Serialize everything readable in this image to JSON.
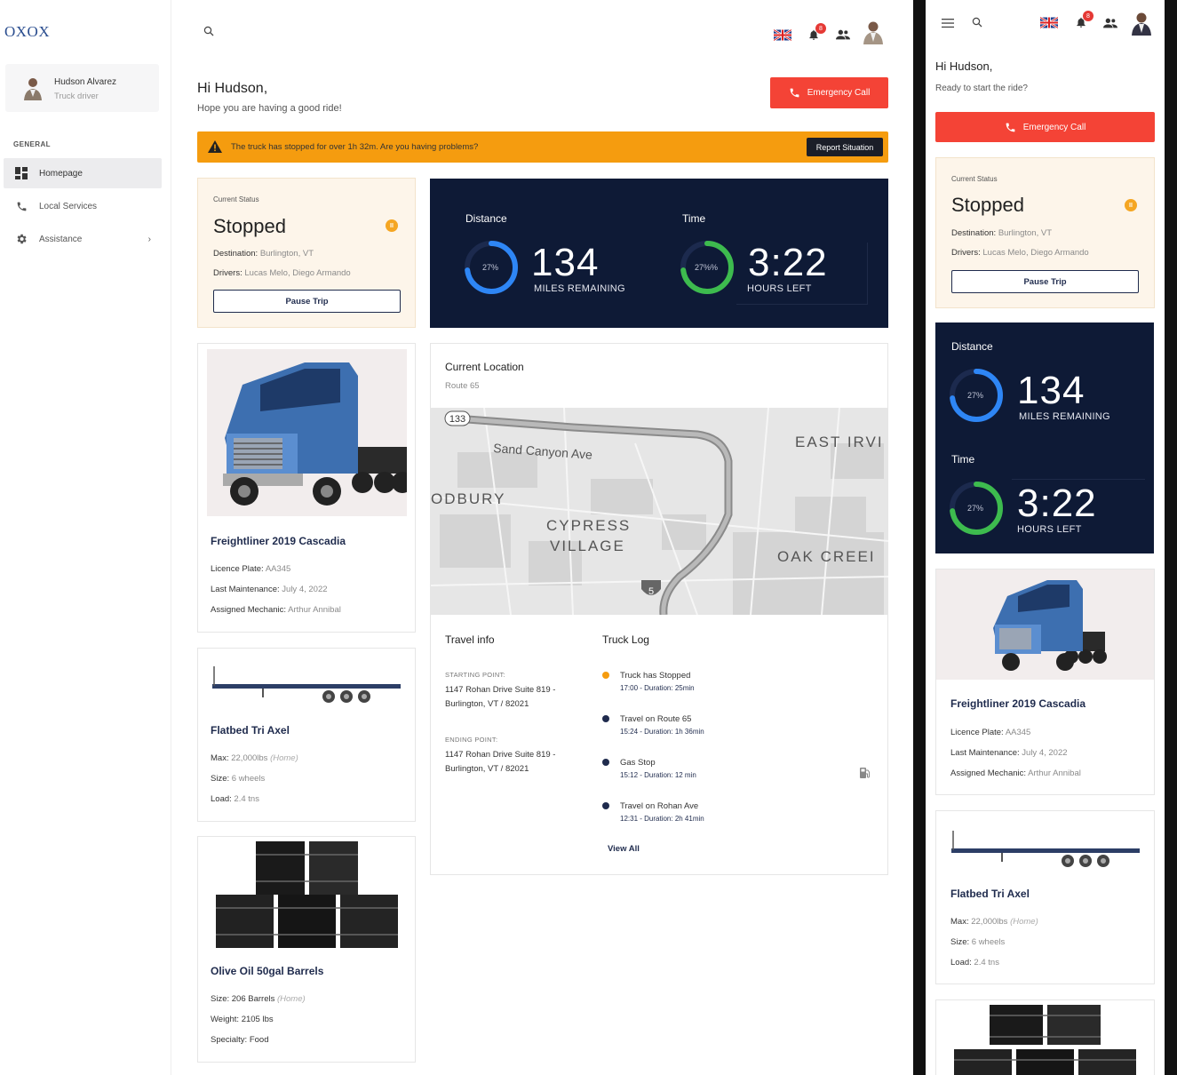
{
  "app": {
    "logo": "OXOX"
  },
  "user": {
    "name": "Hudson Alvarez",
    "role": "Truck driver"
  },
  "nav": {
    "section": "GENERAL",
    "items": [
      {
        "label": "Homepage",
        "icon": "dashboard-icon"
      },
      {
        "label": "Local Services",
        "icon": "phone-icon"
      },
      {
        "label": "Assistance",
        "icon": "gear-icon"
      }
    ]
  },
  "header": {
    "notifications": "8"
  },
  "greeting": {
    "title": "Hi Hudson,",
    "subtitle": "Hope you are having a good ride!",
    "mobile_subtitle": "Ready to start the ride?"
  },
  "emergency": {
    "label": "Emergency Call"
  },
  "alert": {
    "text": "The truck has stopped for over 1h 32m. Are you having problems?",
    "button": "Report Situation"
  },
  "status": {
    "caption": "Current Status",
    "value": "Stopped",
    "destination_label": "Destination:",
    "destination": "Burlington, VT",
    "drivers_label": "Drivers:",
    "drivers": "Lucas Melo, Diego Armando",
    "pause_label": "Pause Trip",
    "pause_icon": "II"
  },
  "metrics": {
    "distance": {
      "label": "Distance",
      "value": "134",
      "unit": "MILES REMAINING",
      "pct": "27%",
      "fraction": 0.73
    },
    "time": {
      "label": "Time",
      "value": "3:22",
      "unit": "HOURS LEFT",
      "pct": "27%%",
      "pct_mobile": "27%",
      "fraction": 0.73
    }
  },
  "location": {
    "title": "Current Location",
    "route": "Route 65",
    "map_labels": {
      "road": "Sand Canyon Ave",
      "east": "EAST IRVI",
      "west": "ODBURY",
      "village1": "CYPRESS",
      "village2": "VILLAGE",
      "oak": "OAK CREEI",
      "shield1": "133",
      "shield2": "5"
    }
  },
  "travel": {
    "title": "Travel info",
    "start_label": "STARTING POINT:",
    "start_line1": "1147 Rohan Drive Suite 819 -",
    "start_line2": "Burlington, VT / 82021",
    "end_label": "ENDING POINT:",
    "end_line1": "1147 Rohan Drive Suite 819 -",
    "end_line2": "Burlington, VT / 82021"
  },
  "log": {
    "title": "Truck Log",
    "entries": [
      {
        "title": "Truck has Stopped",
        "sub": "17:00 - Duration: 25min",
        "color": "#f59c0f"
      },
      {
        "title": "Travel on Route 65",
        "sub": "15:24 - Duration: 1h 36min",
        "color": "#1f2b4d"
      },
      {
        "title": "Gas Stop",
        "sub": "15:12 - Duration: 12 min",
        "color": "#1f2b4d"
      },
      {
        "title": "Travel on Rohan Ave",
        "sub": "12:31 - Duration: 2h 41min",
        "color": "#1f2b4d"
      }
    ],
    "view_all": "View All"
  },
  "truck": {
    "title": "Freightliner 2019 Cascadia",
    "plate_label": "Licence Plate:",
    "plate": "AA345",
    "maint_label": "Last Maintenance:",
    "maint": "July 4, 2022",
    "mech_label": "Assigned Mechanic:",
    "mech": "Arthur Annibal"
  },
  "trailer": {
    "title": "Flatbed Tri Axel",
    "max_label": "Max:",
    "max": "22,000lbs",
    "max_note": "(Home)",
    "size_label": "Size:",
    "size": "6 wheels",
    "load_label": "Load:",
    "load": "2.4 tns"
  },
  "cargo": {
    "title": "Olive Oil 50gal Barrels",
    "size_label": "Size:",
    "size": "206 Barrels",
    "size_note": "(Home)",
    "weight_label": "Weight:",
    "weight": "2105 lbs",
    "spec_label": "Specialty:",
    "spec": "Food"
  },
  "colors": {
    "accent": "#1f2b4d",
    "emergency": "#f44336",
    "warning": "#f59c0f",
    "dark": "#0e1a36",
    "blue_ring": "#2e86f5",
    "green_ring": "#3dbb4e"
  }
}
